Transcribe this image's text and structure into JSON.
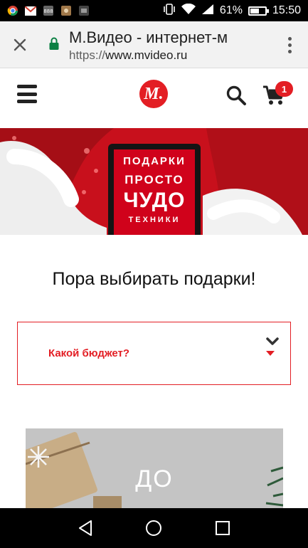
{
  "status_bar": {
    "battery_percent": "61%",
    "battery_level": 0.61,
    "time": "15:50",
    "notification_icons": [
      "chrome-icon",
      "gmail-icon",
      "app-icon",
      "app-icon",
      "app-icon"
    ]
  },
  "browser": {
    "page_title": "М.Видео - интернет-м",
    "url_scheme": "https://",
    "url_host": "www.mvideo.ru",
    "secure": true
  },
  "site_header": {
    "logo_text": "М.",
    "cart_count": "1"
  },
  "banner": {
    "line1": "ПОДАРКИ",
    "line2": "ПРОСТО",
    "line3": "ЧУДО",
    "line4": "ТЕХНИКИ"
  },
  "section": {
    "title": "Пора выбирать подарки!",
    "budget_select_label": "Какой бюджет?"
  },
  "gift_card": {
    "text": "ДО"
  },
  "colors": {
    "brand_red": "#e31e24",
    "lock_green": "#0b8043"
  }
}
